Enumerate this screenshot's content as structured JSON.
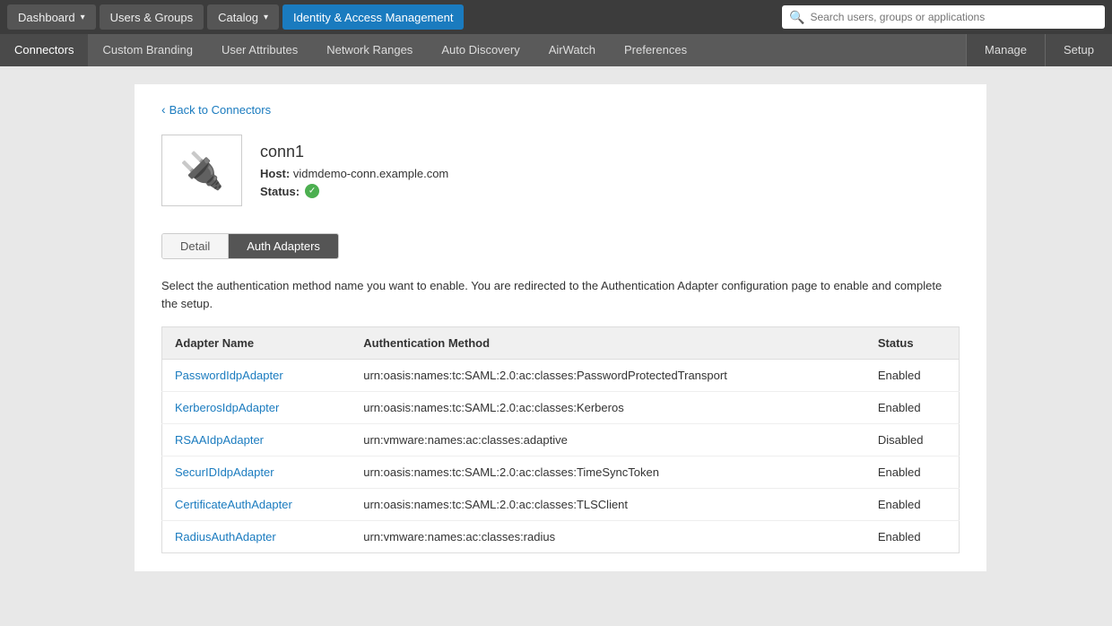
{
  "topNav": {
    "buttons": [
      {
        "id": "dashboard",
        "label": "Dashboard",
        "hasDropdown": true,
        "active": false
      },
      {
        "id": "users-groups",
        "label": "Users & Groups",
        "hasDropdown": false,
        "active": false
      },
      {
        "id": "catalog",
        "label": "Catalog",
        "hasDropdown": true,
        "active": false
      },
      {
        "id": "identity-access",
        "label": "Identity & Access Management",
        "hasDropdown": false,
        "active": true
      }
    ],
    "search": {
      "placeholder": "Search users, groups or applications"
    }
  },
  "secondNav": {
    "items": [
      {
        "id": "connectors",
        "label": "Connectors",
        "active": true
      },
      {
        "id": "custom-branding",
        "label": "Custom Branding",
        "active": false
      },
      {
        "id": "user-attributes",
        "label": "User Attributes",
        "active": false
      },
      {
        "id": "network-ranges",
        "label": "Network Ranges",
        "active": false
      },
      {
        "id": "auto-discovery",
        "label": "Auto Discovery",
        "active": false
      },
      {
        "id": "airwatch",
        "label": "AirWatch",
        "active": false
      },
      {
        "id": "preferences",
        "label": "Preferences",
        "active": false
      }
    ],
    "rightButtons": [
      {
        "id": "manage",
        "label": "Manage"
      },
      {
        "id": "setup",
        "label": "Setup"
      }
    ]
  },
  "breadcrumb": {
    "backLabel": "Back to Connectors"
  },
  "connector": {
    "name": "conn1",
    "hostLabel": "Host:",
    "hostValue": "vidmdemo-conn.example.com",
    "statusLabel": "Status:"
  },
  "tabs": [
    {
      "id": "detail",
      "label": "Detail",
      "active": false
    },
    {
      "id": "auth-adapters",
      "label": "Auth Adapters",
      "active": true
    }
  ],
  "description": "Select the authentication method name you want to enable. You are redirected to the Authentication Adapter configuration page to enable and complete the setup.",
  "tableHeaders": {
    "adapterName": "Adapter Name",
    "authMethod": "Authentication Method",
    "status": "Status"
  },
  "adapters": [
    {
      "name": "PasswordIdpAdapter",
      "authMethod": "urn:oasis:names:tc:SAML:2.0:ac:classes:PasswordProtectedTransport",
      "status": "Enabled"
    },
    {
      "name": "KerberosIdpAdapter",
      "authMethod": "urn:oasis:names:tc:SAML:2.0:ac:classes:Kerberos",
      "status": "Enabled"
    },
    {
      "name": "RSAAIdpAdapter",
      "authMethod": "urn:vmware:names:ac:classes:adaptive",
      "status": "Disabled"
    },
    {
      "name": "SecurIDIdpAdapter",
      "authMethod": "urn:oasis:names:tc:SAML:2.0:ac:classes:TimeSyncToken",
      "status": "Enabled"
    },
    {
      "name": "CertificateAuthAdapter",
      "authMethod": "urn:oasis:names:tc:SAML:2.0:ac:classes:TLSClient",
      "status": "Enabled"
    },
    {
      "name": "RadiusAuthAdapter",
      "authMethod": "urn:vmware:names:ac:classes:radius",
      "status": "Enabled"
    }
  ]
}
